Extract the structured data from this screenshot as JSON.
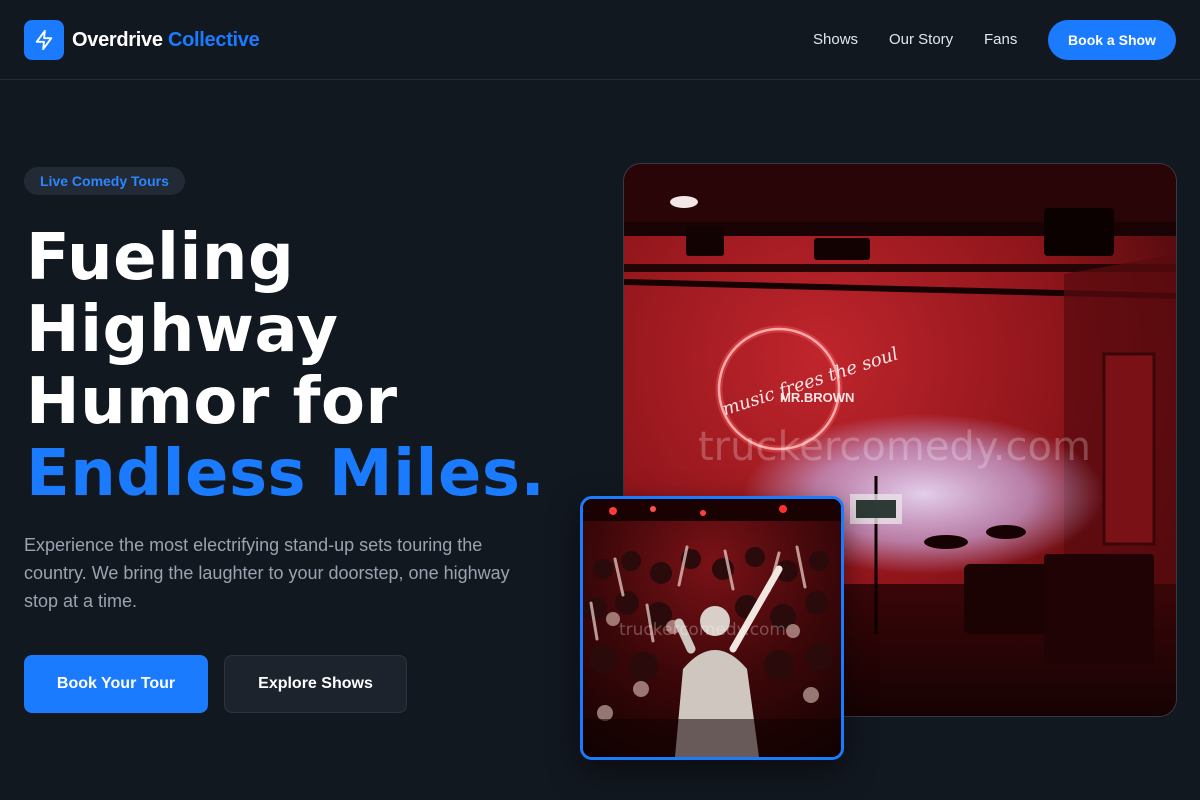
{
  "nav": {
    "brand_primary": "Overdrive",
    "brand_accent": "Collective",
    "logo_icon": "lightning-bolt-icon",
    "links": [
      "Shows",
      "Our Story",
      "Fans"
    ],
    "cta_label": "Book a Show"
  },
  "hero": {
    "badge": "Live Comedy Tours",
    "headline_lines": [
      "Fueling",
      "Highway",
      "Humor for"
    ],
    "headline_accent": "Endless Miles.",
    "description": "Experience the most electrifying stand-up sets touring the country. We bring the laughter to your doorstep, one highway stop at a time.",
    "primary_button": "Book Your Tour",
    "secondary_button": "Explore Shows"
  },
  "images": {
    "main_watermark": "truckercomedy.com",
    "small_watermark": "truckercomedy.com",
    "neon_sign_text": "music frees the soul",
    "neon_sign_subtext": "MR.BROWN"
  },
  "colors": {
    "background": "#121820",
    "accent": "#1a7bff",
    "muted_text": "#9aa3af"
  }
}
